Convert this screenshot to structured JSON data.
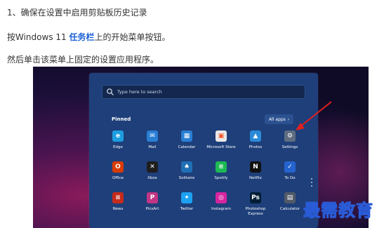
{
  "doc": {
    "step_title": "1、确保在设置中启用剪贴板历史记录",
    "line2_pre": "按Windows 11 ",
    "line2_link": "任务栏",
    "line2_post": "上的开始菜单按钮。",
    "line3": "然后单击该菜单上固定的设置应用程序。"
  },
  "start_menu": {
    "search_placeholder": "Type here to search",
    "pinned_label": "Pinned",
    "all_apps_label": "All apps",
    "apps": [
      {
        "label": "Edge",
        "icon": "edge-icon",
        "color": "#1e9de0"
      },
      {
        "label": "Mail",
        "icon": "mail-icon",
        "color": "#2a7fd4"
      },
      {
        "label": "Calendar",
        "icon": "calendar-icon",
        "color": "#2a7fd4"
      },
      {
        "label": "Microsoft Store",
        "icon": "store-icon",
        "color": "#e8e8e8"
      },
      {
        "label": "Photos",
        "icon": "photos-icon",
        "color": "#2a8ad8"
      },
      {
        "label": "Settings",
        "icon": "settings-icon",
        "color": "#5f6d80"
      },
      {
        "label": "Office",
        "icon": "office-icon",
        "color": "#d83b01"
      },
      {
        "label": "Xbox",
        "icon": "xbox-icon",
        "color": "#1e1e1e"
      },
      {
        "label": "Solitaire",
        "icon": "solitaire-icon",
        "color": "#1f6fb5"
      },
      {
        "label": "Spotify",
        "icon": "spotify-icon",
        "color": "#1db954"
      },
      {
        "label": "Netflix",
        "icon": "netflix-icon",
        "color": "#111111"
      },
      {
        "label": "To Do",
        "icon": "todo-icon",
        "color": "#2564cf"
      },
      {
        "label": "News",
        "icon": "news-icon",
        "color": "#c42b1c"
      },
      {
        "label": "PicsArt",
        "icon": "picsart-icon",
        "color": "#c13584"
      },
      {
        "label": "Twitter",
        "icon": "twitter-icon",
        "color": "#1da1f2"
      },
      {
        "label": "Instagram",
        "icon": "instagram-icon",
        "color": "#d6249f"
      },
      {
        "label": "Photoshop Express",
        "icon": "photoshop-express-icon",
        "color": "#001e36"
      },
      {
        "label": "Calculator",
        "icon": "calculator-icon",
        "color": "#505a68"
      }
    ]
  },
  "watermark": "最需教育"
}
